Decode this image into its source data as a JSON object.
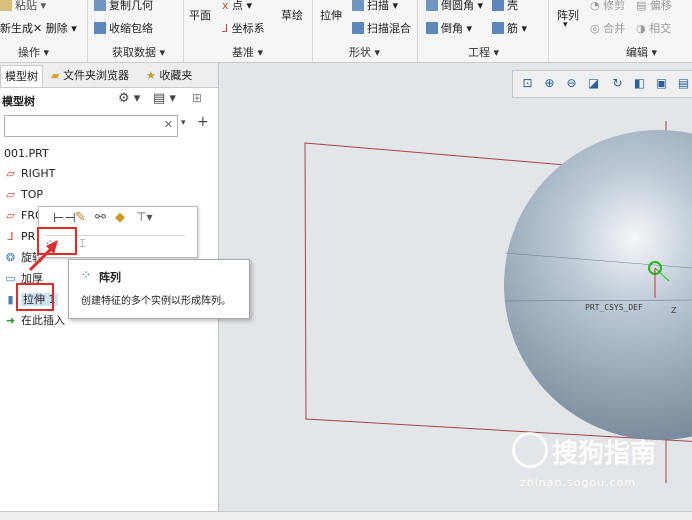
{
  "ribbon": {
    "row1": {
      "paste": "粘贴",
      "copy_geom": "复制几何",
      "point": "点",
      "sweep": "扫描",
      "round": "倒圆角",
      "shell": "壳",
      "trim": "修剪",
      "offset": "偏移"
    },
    "items": {
      "generate": "新生成",
      "delete": "删除",
      "shrinkwrap": "收缩包络",
      "plane": "平面",
      "coordsys": "坐标系",
      "sketch": "草绘",
      "extrude": "拉伸",
      "swept_blend": "扫描混合",
      "chamfer": "倒角",
      "rib": "筋",
      "pattern": "阵列",
      "merge": "合并",
      "intersect": "相交"
    },
    "groups": {
      "operations": "操作",
      "get_data": "获取数据",
      "datum": "基准",
      "shapes": "形状",
      "engineering": "工程",
      "editing": "编辑"
    }
  },
  "panel": {
    "tabs": [
      "模型树",
      "文件夹浏览器",
      "收藏夹"
    ],
    "header": "模型树",
    "search_placeholder": "",
    "tree": [
      "001.PRT",
      "RIGHT",
      "TOP",
      "FRON",
      "PR",
      "旋转",
      "加厚",
      "拉伸 1",
      "在此插入"
    ]
  },
  "tooltip": {
    "title": "阵列",
    "description": "创建特征的多个实例以形成阵列。"
  },
  "graphics": {
    "csys_label": "PRT_CSYS_DEF",
    "axis_z": "Z"
  },
  "watermark": {
    "brand": "搜狗指南",
    "url": "zhinan.sogou.com"
  },
  "colors": {
    "accent": "#2d5f9a",
    "highlight": "#e02b2b",
    "sphere": "#a9b8c7"
  }
}
